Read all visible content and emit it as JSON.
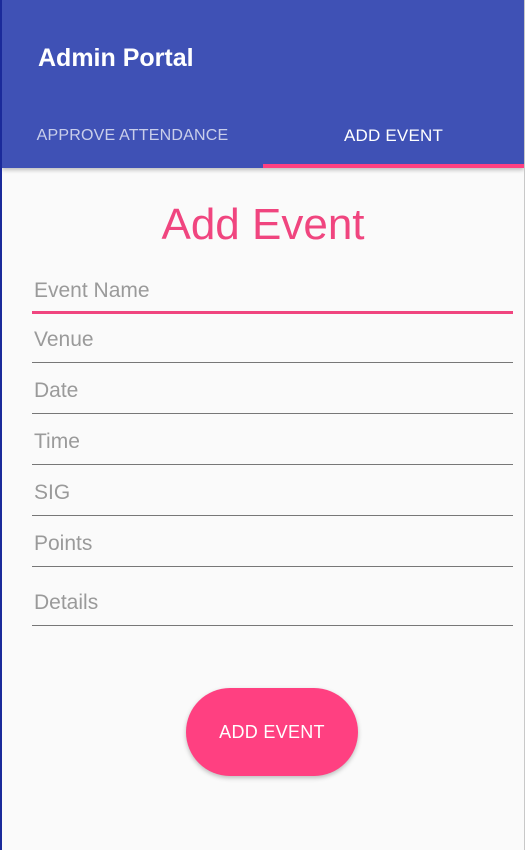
{
  "app_bar": {
    "title": "Admin Portal"
  },
  "tabs": [
    {
      "label": "APPROVE ATTENDANCE",
      "selected": false
    },
    {
      "label": "ADD EVENT",
      "selected": true
    }
  ],
  "form": {
    "title": "Add Event",
    "fields": [
      {
        "placeholder": "Event Name",
        "value": "",
        "focused": true
      },
      {
        "placeholder": "Venue",
        "value": ""
      },
      {
        "placeholder": "Date",
        "value": ""
      },
      {
        "placeholder": "Time",
        "value": ""
      },
      {
        "placeholder": "SIG",
        "value": ""
      },
      {
        "placeholder": "Points",
        "value": ""
      },
      {
        "placeholder": "Details",
        "value": ""
      }
    ],
    "submit_label": "ADD EVENT"
  },
  "colors": {
    "primary": "#3f51b5",
    "accent": "#ff4081",
    "title_text": "#f0457f",
    "background": "#fafafa"
  }
}
